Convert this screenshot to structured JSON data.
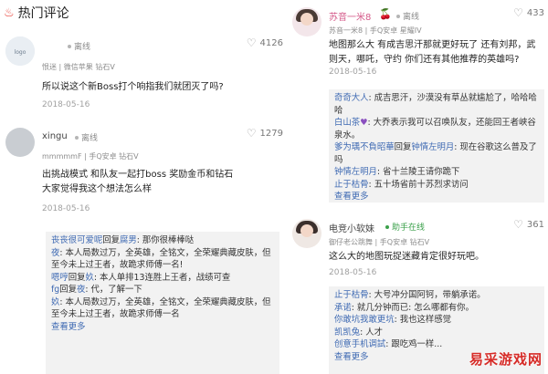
{
  "section": {
    "title": "热门评论",
    "icon": "fire-icon"
  },
  "left": {
    "c1": {
      "username": "",
      "status": "离线",
      "likes": "4126",
      "meta": "恨迷 | 微信苹果 钻石V",
      "body": "所以说这个新Boss打个响指我们就团灭了吗?",
      "date": "2018-05-16"
    },
    "c2": {
      "username": "xingu",
      "status": "离线",
      "likes": "1279",
      "meta": "mmmmmF | 手Q安卓 钻石V",
      "body": "出挑战模式 和队友一起打boss 奖励金币和钻石 大家觉得我这个想法怎么样",
      "date": "2018-05-16",
      "replies": [
        {
          "name": "丧丧很可爱呢",
          "text": "回复",
          "target": "腐男",
          "after": ": 那你很棒棒哒"
        },
        {
          "name": "夜",
          "text": ": 本人局数过万，全英雄，全铭文，全荣耀典藏皮肤，但至今未上过王者，故跪求师傅一名!"
        },
        {
          "name": "嗯哼",
          "text": "回复",
          "target": "奺",
          "after": ": 本人单排13连胜上王者，战绩可查"
        },
        {
          "name": "fg",
          "text": "回复",
          "target": "夜",
          "after": ": 代，了解一下"
        },
        {
          "name": "奺",
          "text": ": 本人局数过万，全英雄，全铭文，全荣耀典藏皮肤，但至今未上过王者，故跪求师傅一名"
        }
      ],
      "more": "查看更多"
    }
  },
  "right": {
    "c3": {
      "username": "苏音一米8",
      "status": "离线",
      "likes": "433",
      "meta": "苏音一米8 | 手Q安卓 星耀IV",
      "body": "地图那么大 有成吉思汗那就更好玩了 还有刘邦，武则天，哪吒，守约 你们还有其他推荐的英雄吗?",
      "date": "2018-05-16",
      "replies": [
        {
          "name": "奇奇大人",
          "text": ": 成吉思汗，沙漠没有草丛就尴尬了，哈哈哈哈"
        },
        {
          "name": "白山茶",
          "text": ": 大乔表示我可以召唤队友，还能回王者峡谷泉水。"
        },
        {
          "name": "爹为瑀不負昭華",
          "text": "回复",
          "target": "钟情左明月",
          "after": ": 现在谷歌这么普及了吗"
        },
        {
          "name": "钟情左明月",
          "text": ": 省十兰陵王请你跪下"
        },
        {
          "name": "止于枯骨",
          "text": ": 五十场省前十苏烈求访问"
        }
      ],
      "more": "查看更多"
    },
    "c4": {
      "username": "电竞小软妹",
      "status": "助手在线",
      "likes": "361",
      "meta": "御仔老公跳舞 | 手Q安卓 钻石V",
      "body": "这么大的地图玩捉迷藏肯定很好玩吧。",
      "date": "2018-05-16",
      "replies": [
        {
          "name": "止于枯骨",
          "text": ": 大号冲分国阿钶，带躺承诺。"
        },
        {
          "name": "承诺",
          "text": ": 就几分钟而已: 怎么哪都有你。"
        },
        {
          "name": "你敢坑我敢更坑",
          "text": ": 我也这样感觉"
        },
        {
          "name": "凯凯兔",
          "text": ": 人才"
        },
        {
          "name": "创意手机调試",
          "text": ": 跟吃鸡一样..."
        }
      ],
      "more": "查看更多"
    }
  },
  "watermark": "易采游戏网"
}
